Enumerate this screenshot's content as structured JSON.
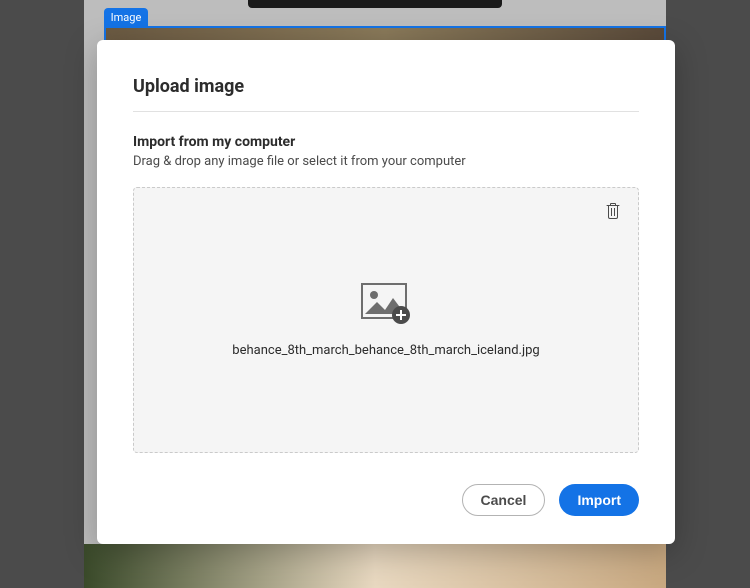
{
  "background": {
    "tab_label": "Image"
  },
  "modal": {
    "title": "Upload image",
    "section_heading": "Import from my computer",
    "section_subtext": "Drag & drop any image file or select it from your computer",
    "dropzone": {
      "filename": "behance_8th_march_behance_8th_march_iceland.jpg"
    },
    "buttons": {
      "cancel": "Cancel",
      "import": "Import"
    }
  }
}
